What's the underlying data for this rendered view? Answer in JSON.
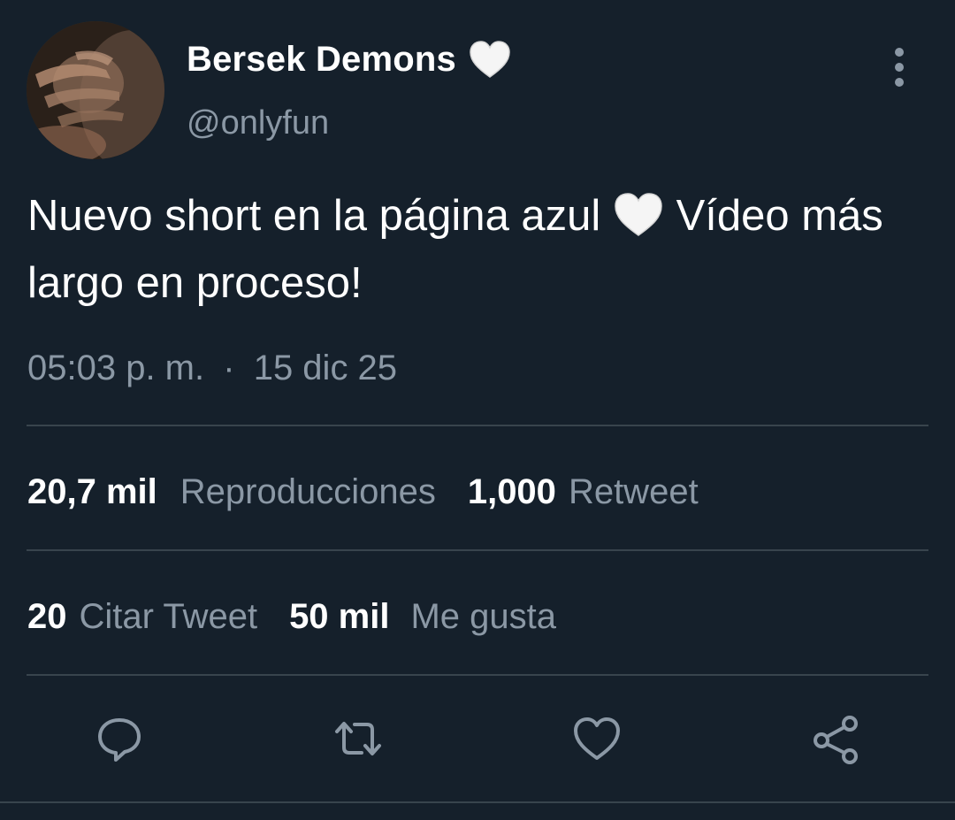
{
  "tweet": {
    "display_name": "Bersek Demons",
    "name_emoji": "white-heart-emoji",
    "handle": "@onlyfun",
    "text_part1": "Nuevo short en la página azul",
    "text_part2": "Vídeo más largo en proceso!",
    "text_emoji": "white-heart-emoji",
    "time": "05:03 p. m.",
    "separator": "·",
    "date": "15 dic 25"
  },
  "stats": {
    "views_count": "20,7 mil",
    "views_label": "Reproducciones",
    "retweets_count": "1,000",
    "retweets_label": "Retweet",
    "quotes_count": "20",
    "quotes_label": "Citar Tweet",
    "likes_count": "50 mil",
    "likes_label": "Me gusta"
  },
  "actions": [
    {
      "name": "reply",
      "icon": "comment-icon"
    },
    {
      "name": "retweet",
      "icon": "retweet-icon"
    },
    {
      "name": "like",
      "icon": "heart-icon"
    },
    {
      "name": "share",
      "icon": "share-icon"
    }
  ],
  "colors": {
    "background": "#15202b",
    "text_primary": "#ffffff",
    "text_secondary": "#8b98a5",
    "divider": "#38444d"
  }
}
